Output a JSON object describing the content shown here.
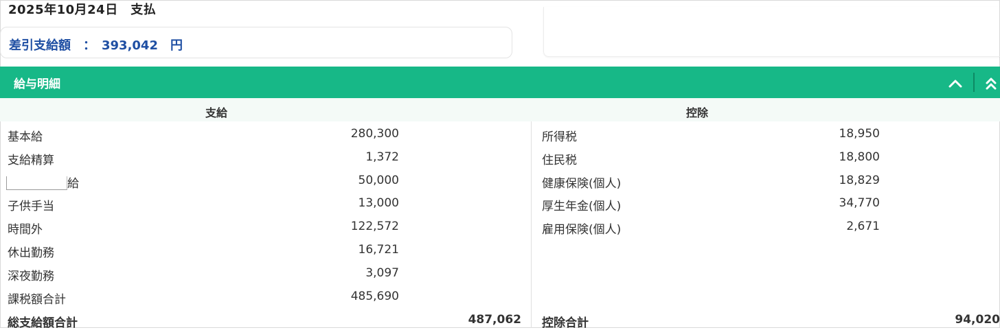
{
  "payment": {
    "date_label": "2025年10月24日　支払",
    "net_label": "差引支給額　：　393,042　円"
  },
  "section": {
    "title": "給与明細",
    "collapse_icon": "chevron-up-icon",
    "collapse_all_icon": "double-chevron-up-icon"
  },
  "columns": {
    "payments_header": "支給",
    "deductions_header": "控除"
  },
  "payments": [
    {
      "label": "基本給",
      "value": "280,300"
    },
    {
      "label": "支給精算",
      "value": "1,372"
    },
    {
      "label": "給",
      "value": "50,000"
    },
    {
      "label": "子供手当",
      "value": "13,000"
    },
    {
      "label": "時間外",
      "value": "122,572"
    },
    {
      "label": "休出勤務",
      "value": "16,721"
    },
    {
      "label": "深夜勤務",
      "value": "3,097"
    },
    {
      "label": "課税額合計",
      "value": "485,690"
    }
  ],
  "payments_total": {
    "label": "総支給額合計",
    "value": "487,062"
  },
  "deductions": [
    {
      "label": "所得税",
      "value": "18,950"
    },
    {
      "label": "住民税",
      "value": "18,800"
    },
    {
      "label": "健康保険(個人)",
      "value": "18,829"
    },
    {
      "label": "厚生年金(個人)",
      "value": "34,770"
    },
    {
      "label": "雇用保険(個人)",
      "value": "2,671"
    }
  ],
  "deductions_total": {
    "label": "控除合計",
    "value": "94,020"
  },
  "colors": {
    "accent_green": "#17b887",
    "net_amount_blue": "#1f4fa3"
  }
}
